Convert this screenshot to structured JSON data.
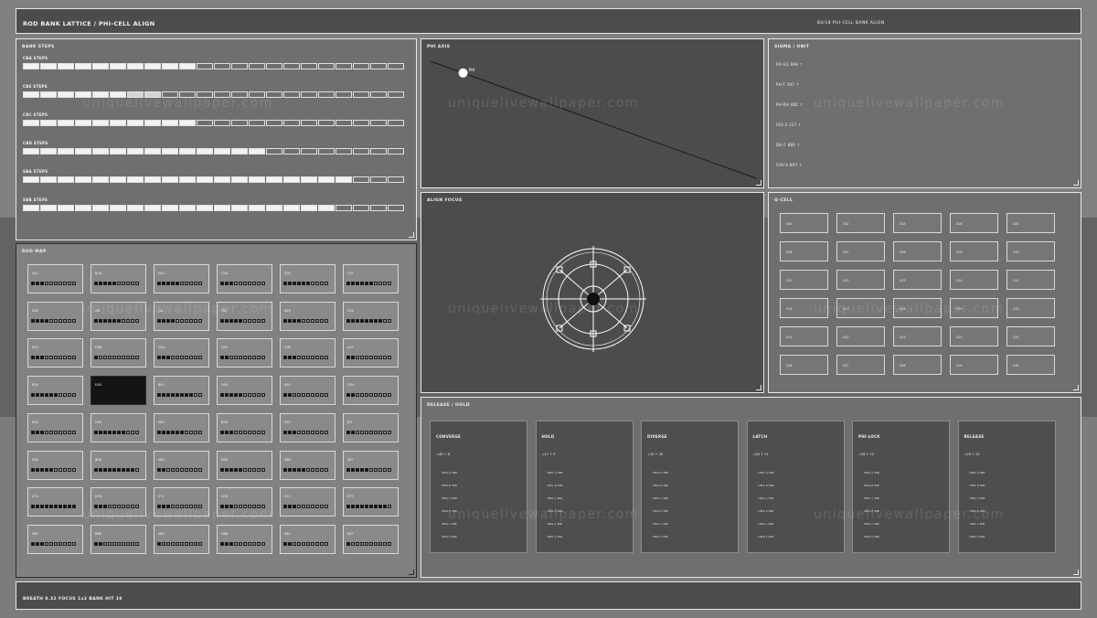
{
  "header": {
    "title": "ROD BANK LATTICE / PHI-CELL ALIGN",
    "status": "84/18 PHI-CELL BANK ALIGN"
  },
  "bank_steps": {
    "title": "BANK STEPS",
    "total_steps": 22,
    "banks": [
      {
        "label": "CBA STEPS",
        "on": 10,
        "half": 0
      },
      {
        "label": "CBE STEPS",
        "on": 6,
        "half": 2
      },
      {
        "label": "CBC STEPS",
        "on": 10,
        "half": 0
      },
      {
        "label": "CBD STEPS",
        "on": 14,
        "half": 0
      },
      {
        "label": "SBA STEPS",
        "on": 19,
        "half": 0
      },
      {
        "label": "SBB STEPS",
        "on": 18,
        "half": 0
      }
    ]
  },
  "phi_axis": {
    "title": "PHI AXIS",
    "marker_label": "PHI",
    "position": 0.1
  },
  "sigma": {
    "title": "SIGMA / UNIT",
    "items": [
      "RX-G1 998 ↑",
      "PH-T 397 ↑",
      "PH-RH 482 ↑",
      "ISO-2 337 ↑",
      "DH-F 886 ↑",
      "CRV-X 897 ↑"
    ]
  },
  "rod_map": {
    "title": "ROD MAP",
    "rows": [
      [
        {
          "id": "S01",
          "on": 3
        },
        {
          "id": "B16",
          "on": 5
        },
        {
          "id": "H22",
          "on": 5
        },
        {
          "id": "C26",
          "on": 3
        },
        {
          "id": "D32",
          "on": 6
        },
        {
          "id": "C37",
          "on": 6
        }
      ],
      [
        {
          "id": "G02",
          "on": 4
        },
        {
          "id": "I08",
          "on": 6
        },
        {
          "id": "J14",
          "on": 4
        },
        {
          "id": "F20",
          "on": 5
        },
        {
          "id": "N29",
          "on": 4
        },
        {
          "id": "E34",
          "on": 8
        }
      ],
      [
        {
          "id": "S03",
          "on": 3
        },
        {
          "id": "D38",
          "on": 1
        },
        {
          "id": "Q44",
          "on": 3
        },
        {
          "id": "A50",
          "on": 2
        },
        {
          "id": "D35",
          "on": 3
        },
        {
          "id": "A37",
          "on": 2
        }
      ],
      [
        {
          "id": "R04",
          "on": 6
        },
        {
          "id": "E48",
          "on": 0
        },
        {
          "id": "B43",
          "on": 8
        },
        {
          "id": "H45",
          "on": 5
        },
        {
          "id": "K40",
          "on": 2
        },
        {
          "id": "D34",
          "on": 2
        }
      ],
      [
        {
          "id": "S05",
          "on": 3
        },
        {
          "id": "D50",
          "on": 7
        },
        {
          "id": "N51",
          "on": 6
        },
        {
          "id": "B56",
          "on": 3
        },
        {
          "id": "E52",
          "on": 3
        },
        {
          "id": "J57",
          "on": 2
        }
      ],
      [
        {
          "id": "S06",
          "on": 5
        },
        {
          "id": "B08",
          "on": 9
        },
        {
          "id": "N61",
          "on": 2
        },
        {
          "id": "R66",
          "on": 5
        },
        {
          "id": "N62",
          "on": 5
        },
        {
          "id": "S67",
          "on": 5
        }
      ],
      [
        {
          "id": "S70",
          "on": 10
        },
        {
          "id": "B78",
          "on": 3
        },
        {
          "id": "S71",
          "on": 3
        },
        {
          "id": "D76",
          "on": 3
        },
        {
          "id": "S72",
          "on": 3
        },
        {
          "id": "E77",
          "on": 9
        }
      ],
      [
        {
          "id": "S80",
          "on": 3
        },
        {
          "id": "B88",
          "on": 2
        },
        {
          "id": "N81",
          "on": 1
        },
        {
          "id": "D86",
          "on": 3
        },
        {
          "id": "S82",
          "on": 2
        },
        {
          "id": "E87",
          "on": 1
        }
      ]
    ],
    "selected": "E48"
  },
  "align_focus": {
    "title": "ALIGN FOCUS"
  },
  "q_cell": {
    "title": "Q-CELL",
    "rows": [
      [
        "G01",
        "G02",
        "G03",
        "G04",
        "G05"
      ],
      [
        "G06",
        "G07",
        "G08",
        "G09",
        "G10"
      ],
      [
        "G11",
        "G12",
        "G13",
        "G14",
        "G15"
      ],
      [
        "G16",
        "G17",
        "G18",
        "G19",
        "G20"
      ],
      [
        "G21",
        "G22",
        "G23",
        "G24",
        "G25"
      ],
      [
        "G26",
        "G27",
        "G28",
        "G29",
        "G30"
      ]
    ]
  },
  "release": {
    "title": "RELEASE / HOLD",
    "columns": [
      {
        "title": "CONVERGE",
        "sub": "⊥48 ↑ 8",
        "cells": [
          "CELL α 396",
          "CELL β 396",
          "CELL γ 396",
          "CELL δ 396",
          "CELL ε 396",
          "CELL ζ 396"
        ]
      },
      {
        "title": "HOLD",
        "sub": "⊥17 ↑ 9",
        "cells": [
          "CELL α 396",
          "CELL β 396",
          "CELL γ 396",
          "CELL δ 396",
          "CELL ε 396",
          "CELL ζ 396"
        ]
      },
      {
        "title": "DIVERGE",
        "sub": "⊥34 ↑ 30",
        "cells": [
          "CELL α 396",
          "CELL β 396",
          "CELL γ 396",
          "CELL δ 396",
          "CELL ε 396",
          "CELL ζ 396"
        ]
      },
      {
        "title": "LATCH",
        "sub": "⊥40 ↑ 11",
        "cells": [
          "CELL α 396",
          "CELL β 396",
          "CELL γ 396",
          "CELL δ 396",
          "CELL ε 396",
          "CELL ζ 396"
        ]
      },
      {
        "title": "PHI-LOCK",
        "sub": "⊥38 ↑ 12",
        "cells": [
          "CELL α 396",
          "CELL β 396",
          "CELL γ 396",
          "CELL δ 396",
          "CELL ε 396",
          "CELL ζ 396"
        ]
      },
      {
        "title": "RELEASE",
        "sub": "⊥29 ↑ 12",
        "cells": [
          "CELL α 396",
          "CELL β 396",
          "CELL γ 396",
          "CELL δ 396",
          "CELL ε 396",
          "CELL ζ 396"
        ]
      }
    ]
  },
  "footer": {
    "status": "BREATH 8.32  FOCUS 1x2  BANK HIT 19"
  },
  "watermark": "uniquelivewallpaper.com"
}
